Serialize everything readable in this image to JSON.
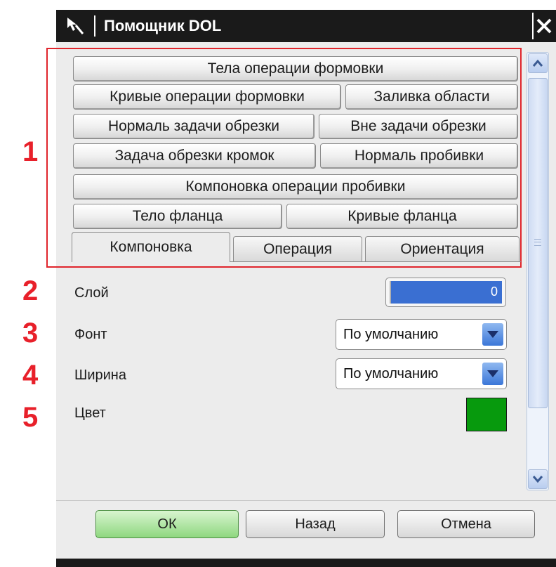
{
  "dialog": {
    "title": "Помощник DOL"
  },
  "categories": {
    "body_forming": "Тела операции формовки",
    "curves_forming": "Кривые операции формовки",
    "area_fill": "Заливка области",
    "trim_normal": "Нормаль задачи обрезки",
    "outside_trim": "Вне задачи обрезки",
    "edge_trim": "Задача обрезки кромок",
    "pierce_normal": "Нормаль пробивки",
    "pierce_layout": "Компоновка операции пробивки",
    "flange_body": "Тело фланца",
    "flange_curves": "Кривые фланца"
  },
  "tabs": {
    "layout": "Компоновка",
    "operation": "Операция",
    "orientation": "Ориентация",
    "active": "layout"
  },
  "fields": {
    "layer_label": "Слой",
    "layer_value": "0",
    "font_label": "Фонт",
    "font_value": "По умолчанию",
    "width_label": "Ширина",
    "width_value": "По умолчанию",
    "color_label": "Цвет",
    "color_value": "#079a0d"
  },
  "markers": [
    "1",
    "2",
    "3",
    "4",
    "5"
  ],
  "buttons": {
    "ok": "ОК",
    "back": "Назад",
    "cancel": "Отмена"
  },
  "colors": {
    "highlight": "#e0252c",
    "marker": "#e8202a",
    "selection": "#3a6fd2",
    "ok_button": "#8ed77f"
  },
  "icons": {
    "title": "cursor-arrow-icon",
    "close": "close-icon",
    "scroll_up": "chevron-up-icon",
    "scroll_down": "chevron-down-icon",
    "dropdown": "chevron-down-icon"
  }
}
